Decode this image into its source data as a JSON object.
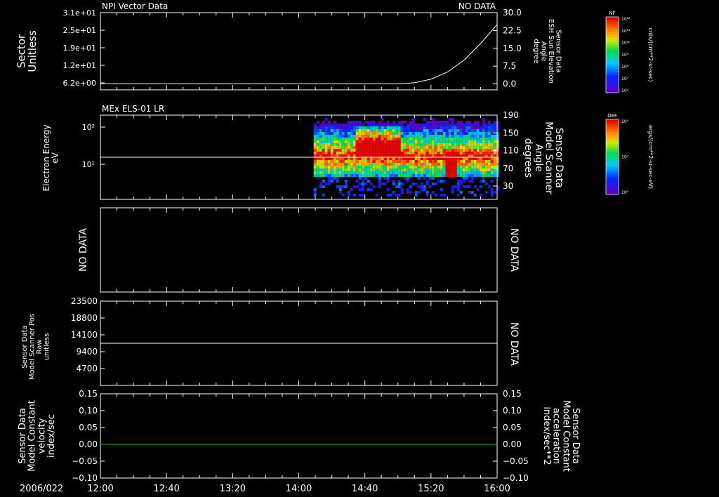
{
  "date_label": "2006/022",
  "x_axis": {
    "tick_labels": [
      "12:00",
      "12:40",
      "13:20",
      "14:00",
      "14:40",
      "15:20",
      "16:00"
    ],
    "range_minutes": [
      0,
      240
    ]
  },
  "colorbars": [
    {
      "title": "NF",
      "tick_labels": [
        "10¹²",
        "10¹¹",
        "10¹⁰",
        "10⁹",
        "10⁸",
        "10⁷",
        "10⁶"
      ],
      "unit_label": "cnts/(cm**2-sr-sec)"
    },
    {
      "title": "DEF",
      "tick_labels": [
        "10⁴",
        "10²",
        "10⁰"
      ],
      "unit_label": "ergs/(cm**2-sr-sec-eV)"
    }
  ],
  "colors": {
    "axis": "#ffffff",
    "panel5_right": "#00e000",
    "trace": "#ffffff",
    "green_trace": "#00c000"
  },
  "chart_data": [
    {
      "type": "line",
      "title": "NPI Vector Data",
      "right_note": "NO DATA",
      "ylabel": "Sector\nUnitless",
      "y_ticks": [
        "3.1e+01",
        "2.5e+01",
        "1.9e+01",
        "1.2e+01",
        "6.2e+00"
      ],
      "right_ylabel": "Sensor Data\nESH Sun Elevation\nAngle\ndegree",
      "right_ticks": [
        "30.0",
        "22.5",
        "15.0",
        "7.5",
        "0.0"
      ],
      "right_ylim": [
        -2.5,
        30
      ],
      "series": [
        {
          "x": [
            0,
            150,
            180,
            190,
            200,
            210,
            220,
            230,
            240
          ],
          "y": [
            0,
            0,
            0,
            0.5,
            2,
            5,
            10,
            17,
            25
          ]
        }
      ]
    },
    {
      "type": "heatmap",
      "title": "MEx ELS-01 LR",
      "ylabel": "Electron Energy\neV",
      "y_ticks": [
        "10²",
        "10¹"
      ],
      "right_ylabel": "Sensor Data\nModel Scanner\nAngle\ndegrees",
      "right_ticks": [
        "190",
        "150",
        "110",
        "70",
        "30"
      ],
      "right_ylim": [
        0,
        190
      ],
      "data_start_minutes": 129,
      "series": [
        {
          "x": [
            0,
            240
          ],
          "y": [
            95,
            95
          ]
        }
      ]
    },
    {
      "type": "line",
      "left_note": "NO DATA",
      "right_note": "NO DATA"
    },
    {
      "type": "line",
      "ylabel": "Sensor Data\nModel Scanner Pos\nRaw\nunitless",
      "y_ticks": [
        "23500",
        "18800",
        "14100",
        "9400",
        "4700"
      ],
      "ylim": [
        0,
        23500
      ],
      "right_note": "NO DATA",
      "series": [
        {
          "x": [
            0,
            240
          ],
          "y": [
            11750,
            11750
          ]
        }
      ]
    },
    {
      "type": "line",
      "ylabel": "Sensor Data\nModel Constant\nvelocity\nindex/sec",
      "y_ticks": [
        "0.15",
        "0.10",
        "0.05",
        "0.00",
        "−0.05",
        "−0.10"
      ],
      "ylim": [
        -0.1,
        0.15
      ],
      "right_ylabel": "Sensor Data\nModel Constant\nacceleration\nindex/sec**2",
      "right_ticks": [
        "0.15",
        "0.10",
        "0.05",
        "0.00",
        "−0.05",
        "−0.10"
      ],
      "series": [
        {
          "x": [
            0,
            240
          ],
          "y": [
            0,
            0
          ]
        }
      ]
    }
  ]
}
